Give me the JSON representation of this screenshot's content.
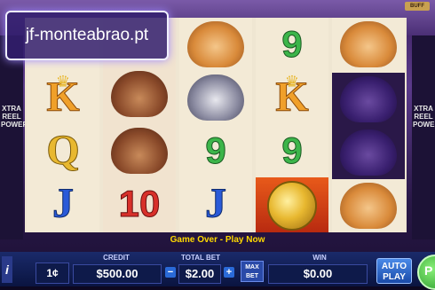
{
  "watermark": "jf-monteabrao.pt",
  "top_badge": "BUFF",
  "side_left": "XTRA\nREEL\nPOWER",
  "side_right": "XTRA\nREEL\nPOWER",
  "reels": [
    [
      "K",
      "Q",
      "J"
    ],
    [
      "elk",
      "elk",
      "10"
    ],
    [
      "cougar",
      "wolf",
      "9",
      "J"
    ],
    [
      "9",
      "K",
      "9",
      "coin"
    ],
    [
      "cougar",
      "buffalo",
      "buffalo",
      "cougar"
    ]
  ],
  "status": "Game Over - Play Now",
  "bottom": {
    "info": "i",
    "denomination": "1¢",
    "credit_label": "CREDIT",
    "credit_value": "$500.00",
    "total_bet_label": "TOTAL BET",
    "total_bet_value": "$2.00",
    "minus": "−",
    "plus": "+",
    "max_bet": "MAX BET",
    "win_label": "WIN",
    "win_value": "$0.00",
    "auto_play": "AUTO PLAY",
    "play": "P"
  }
}
